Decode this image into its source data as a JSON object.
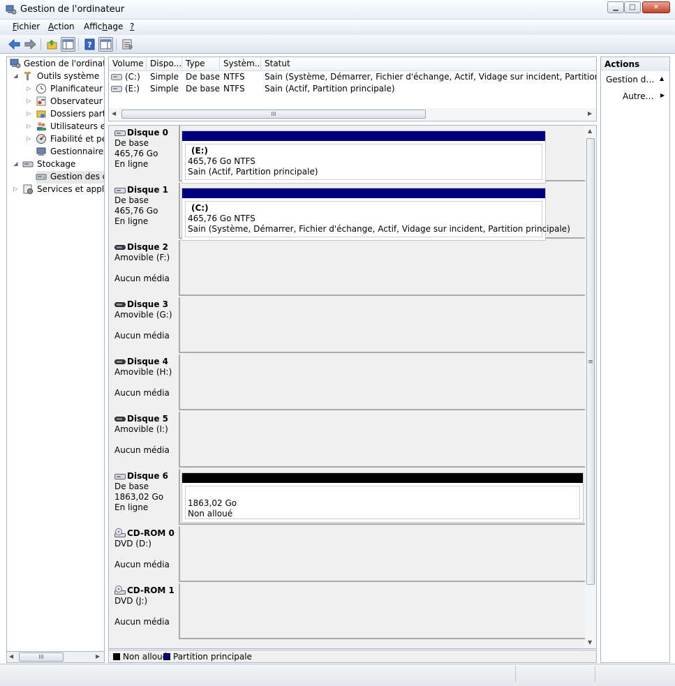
{
  "window": {
    "title": "Gestion de l'ordinateur"
  },
  "menu": [
    {
      "label": "Fichier",
      "key": "F",
      "rest": "ichier"
    },
    {
      "label": "Action",
      "key": "A",
      "rest": "ction"
    },
    {
      "label": "Affichage",
      "pre": "Affic",
      "key": "h",
      "rest": "age"
    },
    {
      "label": "?",
      "key": "?",
      "rest": ""
    }
  ],
  "tree": {
    "items": [
      {
        "label": "Gestion de l'ordinateur",
        "icon": "computer-icon"
      },
      {
        "label": "Outils système",
        "icon": "tools-icon"
      },
      {
        "label": "Planificateur de tâches",
        "icon": "clock-icon"
      },
      {
        "label": "Observateur d'événements",
        "icon": "event-viewer-icon"
      },
      {
        "label": "Dossiers partagés",
        "icon": "shared-folder-icon"
      },
      {
        "label": "Utilisateurs et groupes locaux",
        "icon": "users-icon"
      },
      {
        "label": "Fiabilité et performances",
        "icon": "performance-icon"
      },
      {
        "label": "Gestionnaire de périphériques",
        "icon": "device-manager-icon"
      },
      {
        "label": "Stockage",
        "icon": "storage-icon"
      },
      {
        "label": "Gestion des disques",
        "icon": "disk-management-icon"
      },
      {
        "label": "Services et applications",
        "icon": "services-icon"
      }
    ]
  },
  "volumes": {
    "columns": [
      "Volume",
      "Dispo...",
      "Type",
      "Systèm...",
      "Statut"
    ],
    "rows": [
      {
        "volume": "(C:)",
        "layout": "Simple",
        "type": "De base",
        "fs": "NTFS",
        "status": "Sain (Système, Démarrer, Fichier d'échange, Actif, Vidage sur incident, Partition principale)"
      },
      {
        "volume": "(E:)",
        "layout": "Simple",
        "type": "De base",
        "fs": "NTFS",
        "status": "Sain (Actif, Partition principale)"
      }
    ]
  },
  "disks": [
    {
      "name": "Disque 0",
      "line2": "De base",
      "line3": "465,76 Go",
      "line4": "En ligne",
      "icon": "hard-disk-icon",
      "partition": {
        "label": "(E:)",
        "size": "465,76 Go NTFS",
        "status": "Sain (Actif, Partition principale)",
        "color": "#00007f"
      }
    },
    {
      "name": "Disque 1",
      "line2": "De base",
      "line3": "465,76 Go",
      "line4": "En ligne",
      "icon": "hard-disk-icon",
      "partition": {
        "label": "(C:)",
        "size": "465,76 Go NTFS",
        "status": "Sain (Système, Démarrer, Fichier d'échange, Actif, Vidage sur incident, Partition principale)",
        "color": "#00007f"
      }
    },
    {
      "name": "Disque 2",
      "line2": "Amovible (F:)",
      "line3": "",
      "line4": "Aucun média",
      "icon": "removable-disk-icon"
    },
    {
      "name": "Disque 3",
      "line2": "Amovible (G:)",
      "line3": "",
      "line4": "Aucun média",
      "icon": "removable-disk-icon"
    },
    {
      "name": "Disque 4",
      "line2": "Amovible (H:)",
      "line3": "",
      "line4": "Aucun média",
      "icon": "removable-disk-icon"
    },
    {
      "name": "Disque 5",
      "line2": "Amovible (I:)",
      "line3": "",
      "line4": "Aucun média",
      "icon": "removable-disk-icon"
    },
    {
      "name": "Disque 6",
      "line2": "De base",
      "line3": "1863,02 Go",
      "line4": "En ligne",
      "icon": "hard-disk-icon",
      "partition": {
        "label": "",
        "size": "1863,02 Go",
        "status": "Non alloué",
        "color": "#000000"
      }
    },
    {
      "name": "CD-ROM 0",
      "line2": "DVD (D:)",
      "line3": "",
      "line4": "Aucun média",
      "icon": "cdrom-icon"
    },
    {
      "name": "CD-ROM 1",
      "line2": "DVD (J:)",
      "line3": "",
      "line4": "Aucun média",
      "icon": "cdrom-icon"
    }
  ],
  "legend": [
    {
      "label": "Non alloué",
      "color": "#000000"
    },
    {
      "label": "Partition principale",
      "color": "#00007f"
    }
  ],
  "actions": {
    "header": "Actions",
    "section": "Gestion des disques",
    "item": "Autres actions"
  }
}
